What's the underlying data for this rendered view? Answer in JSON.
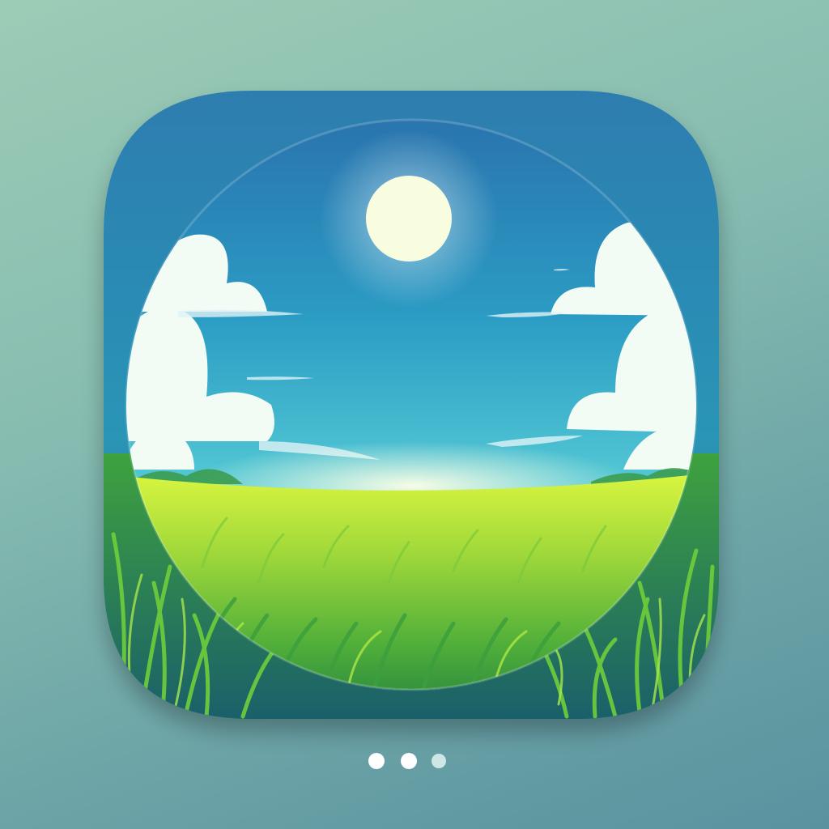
{
  "colors": {
    "background_top": "#9dccb6",
    "background_bottom": "#5a92a0",
    "tile_frame": "#2f86b0",
    "sky_top": "#2b7fb6",
    "sky_horizon": "#bff6f0",
    "sun": "#fafde0",
    "cloud": "#f4fbf6",
    "grass_light": "#c9ef3a",
    "grass_dark": "#2f8a3a",
    "dot_active": "#ffffff",
    "dot_inactive": "#cfe6e6"
  },
  "icon": {
    "scene": "meadow",
    "elements": [
      "sun-icon",
      "cloud-icon",
      "grass-field"
    ]
  },
  "pagination": {
    "total": 3,
    "active_indices": [
      0,
      1
    ]
  }
}
